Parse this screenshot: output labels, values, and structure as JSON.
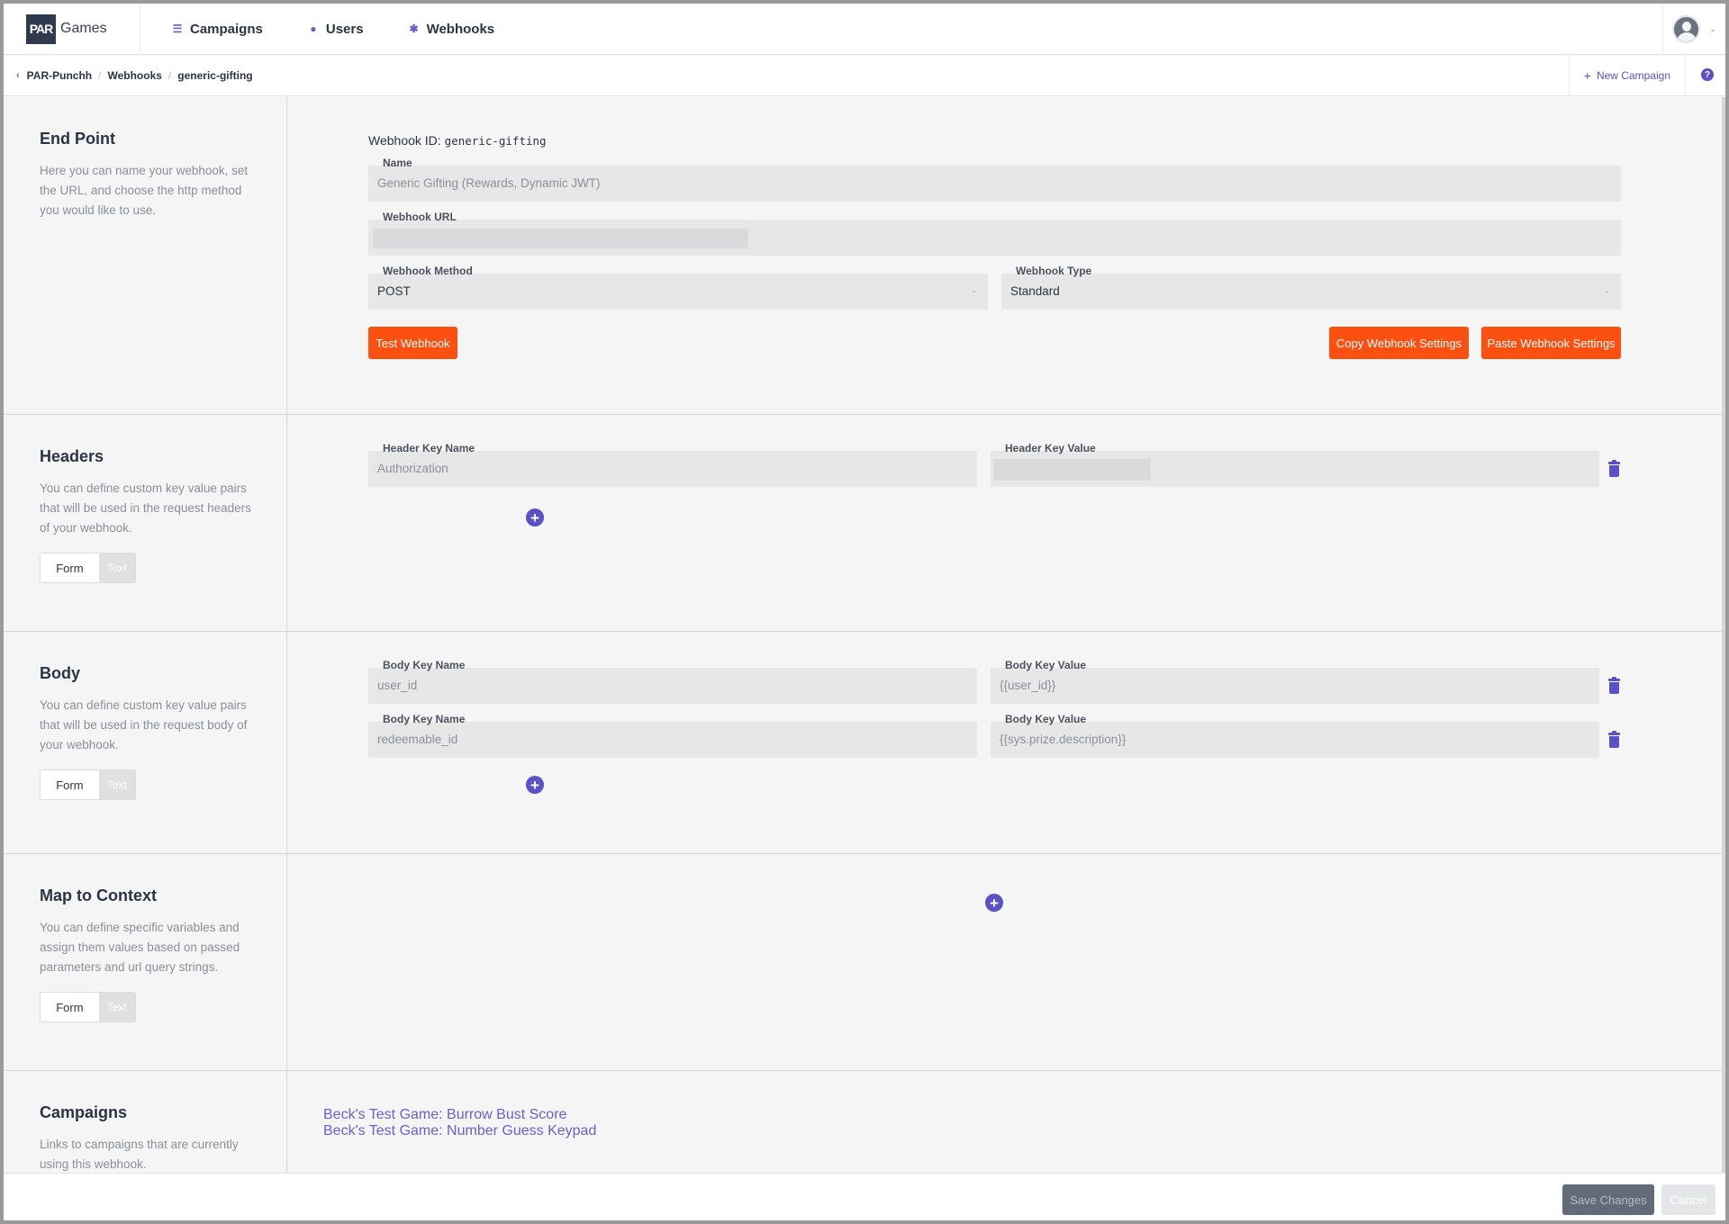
{
  "brand": {
    "logo": "PAR",
    "name": "Games"
  },
  "nav": {
    "items": [
      {
        "label": "Campaigns",
        "icon": "list-icon"
      },
      {
        "label": "Users",
        "icon": "user-icon"
      },
      {
        "label": "Webhooks",
        "icon": "gear-icon"
      }
    ]
  },
  "breadcrumb": {
    "items": [
      "PAR-Punchh",
      "Webhooks",
      "generic-gifting"
    ]
  },
  "actions": {
    "new_campaign": "New Campaign",
    "help": "?"
  },
  "endpoint": {
    "title": "End Point",
    "description": "Here you can name your webhook, set the URL, and choose the http method you would like to use.",
    "id_label": "Webhook ID:",
    "id_value": "generic-gifting",
    "name_label": "Name",
    "name_value": "Generic Gifting (Rewards, Dynamic JWT)",
    "url_label": "Webhook URL",
    "method_label": "Webhook Method",
    "method_value": "POST",
    "type_label": "Webhook Type",
    "type_value": "Standard",
    "test_button": "Test Webhook",
    "copy_button": "Copy Webhook Settings",
    "paste_button": "Paste Webhook Settings"
  },
  "headers": {
    "title": "Headers",
    "description": "You can define custom key value pairs that will be used in the request headers of your webhook.",
    "toggle": {
      "form": "Form",
      "text": "Text"
    },
    "rows": [
      {
        "key_label": "Header Key Name",
        "key": "Authorization",
        "value_label": "Header Key Value"
      }
    ]
  },
  "body": {
    "title": "Body",
    "description": "You can define custom key value pairs that will be used in the request body of your webhook.",
    "toggle": {
      "form": "Form",
      "text": "Text"
    },
    "rows": [
      {
        "key_label": "Body Key Name",
        "key": "user_id",
        "value_label": "Body Key Value",
        "value": "{{user_id}}"
      },
      {
        "key_label": "Body Key Name",
        "key": "redeemable_id",
        "value_label": "Body Key Value",
        "value": "{{sys.prize.description}}"
      }
    ]
  },
  "context": {
    "title": "Map to Context",
    "description": "You can define specific variables and assign them values based on passed parameters and url query strings.",
    "toggle": {
      "form": "Form",
      "text": "Text"
    }
  },
  "campaigns": {
    "title": "Campaigns",
    "description": "Links to campaigns that are currently using this webhook.",
    "links": [
      "Beck's Test Game: Burrow Bust Score",
      "Beck's Test Game: Number Guess Keypad"
    ]
  },
  "footer": {
    "save": "Save Changes",
    "cancel": "Cancel"
  },
  "colors": {
    "accent": "#5b50c8",
    "primary_button": "#fc5011",
    "dark": "#2f3a4e"
  }
}
